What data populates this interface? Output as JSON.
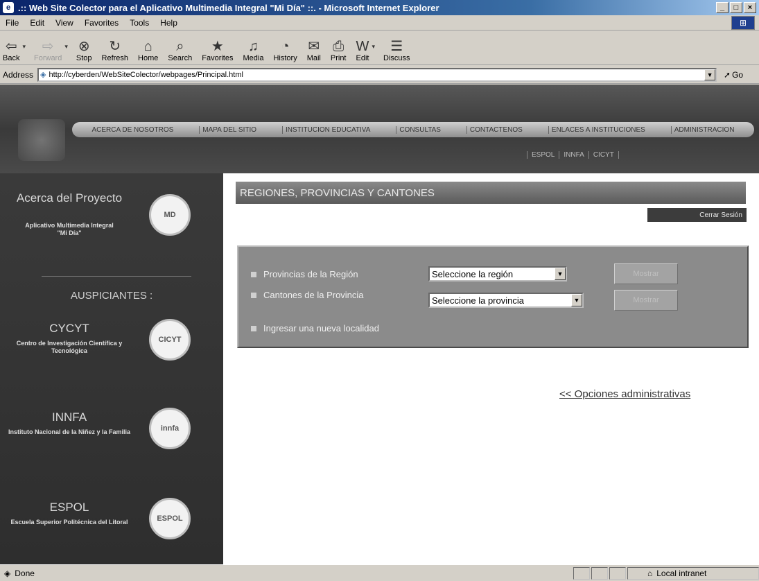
{
  "window": {
    "title": ".:: Web Site Colector para el Aplicativo Multimedia Integral \"Mi Día\" ::. - Microsoft Internet Explorer",
    "controls": [
      "_",
      "□",
      "×"
    ]
  },
  "menu": [
    "File",
    "Edit",
    "View",
    "Favorites",
    "Tools",
    "Help"
  ],
  "toolbar": {
    "back": "Back",
    "forward": "Forward",
    "stop": "Stop",
    "refresh": "Refresh",
    "home": "Home",
    "search": "Search",
    "favorites": "Favorites",
    "media": "Media",
    "history": "History",
    "mail": "Mail",
    "print": "Print",
    "edit": "Edit",
    "discuss": "Discuss"
  },
  "address": {
    "label": "Address",
    "url": "http://cyberden/WebSiteColector/webpages/Principal.html",
    "go": "Go"
  },
  "site": {
    "nav": [
      "ACERCA DE NOSOTROS",
      "MAPA DEL SITIO",
      "INSTITUCION EDUCATIVA",
      "CONSULTAS",
      "CONTACTENOS",
      "ENLACES A INSTITUCIONES",
      "ADMINISTRACION"
    ],
    "subnav": [
      "ESPOL",
      "INNFA",
      "CICYT"
    ]
  },
  "sidebar": {
    "about_title": "Acerca del Proyecto",
    "about_sub": "Aplicativo Multimedia Integral \"Mi Día\"",
    "sponsors_heading": "AUSPICIANTES :",
    "sponsors": [
      {
        "title": "CYCYT",
        "sub": "Centro de Investigación Científica y Tecnológica",
        "badge": "CICYT"
      },
      {
        "title": "INNFA",
        "sub": "Instituto Nacional de la Niñez y la Familia",
        "badge": "innfa"
      },
      {
        "title": "ESPOL",
        "sub": "Escuela Superior Politécnica del Litoral",
        "badge": "ESPOL"
      }
    ]
  },
  "main": {
    "heading": "REGIONES, PROVINCIAS Y CANTONES",
    "logout": "Cerrar Sesión",
    "rows": [
      {
        "label": "Provincias de la Región",
        "select": "Seleccione la región",
        "button": "Mostrar"
      },
      {
        "label": "Cantones de la Provincia",
        "select": "Seleccione la provincia",
        "button": "Mostrar"
      },
      {
        "label": "Ingresar una nueva localidad"
      }
    ],
    "admin_link": "<< Opciones administrativas"
  },
  "status": {
    "text": "Done",
    "zone": "Local intranet"
  }
}
